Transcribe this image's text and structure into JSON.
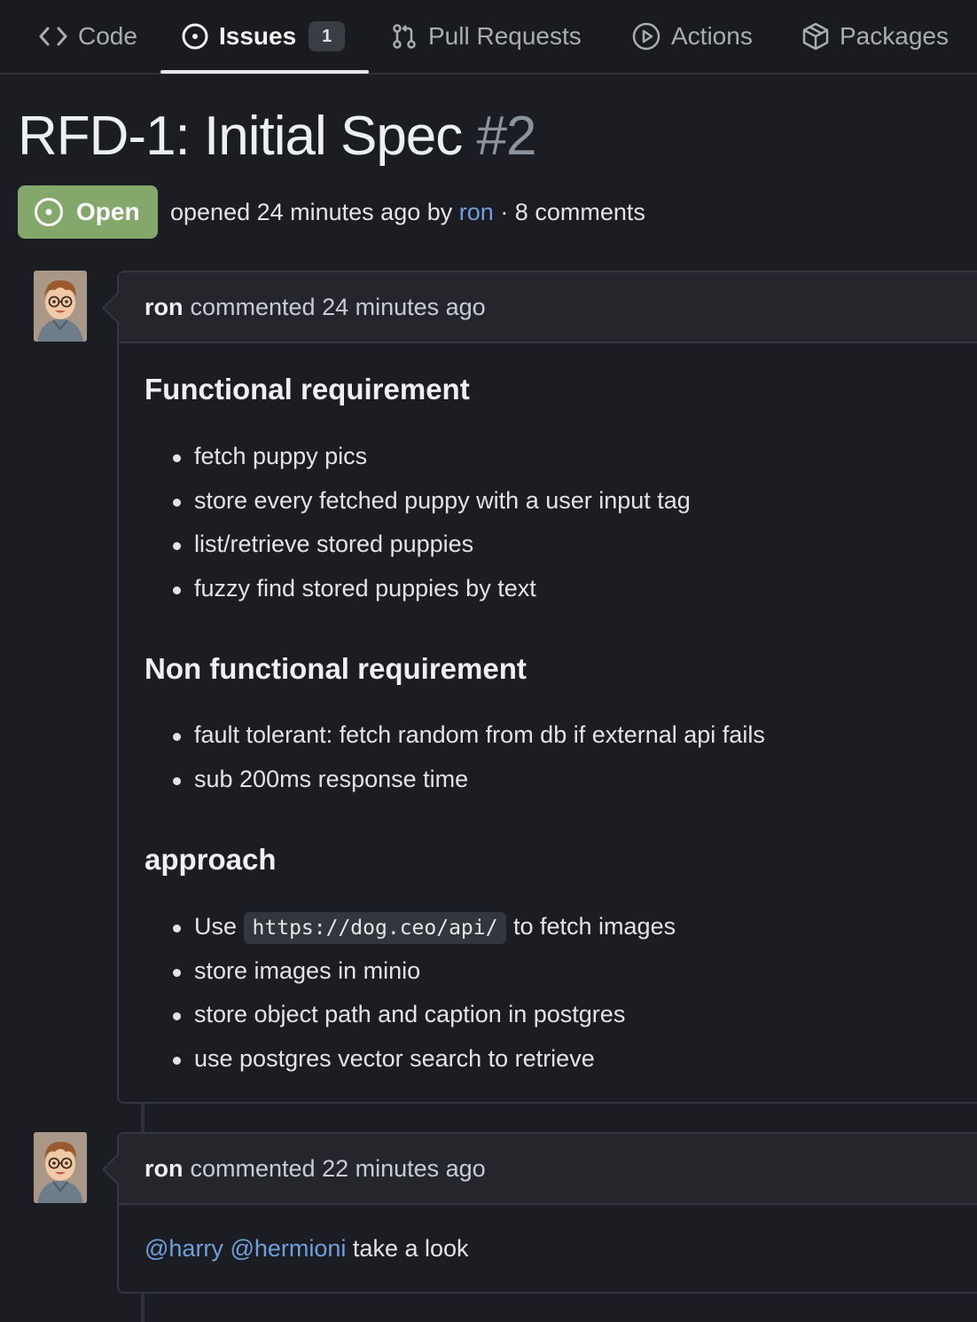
{
  "nav": {
    "tabs": [
      {
        "label": "Code",
        "icon": "code-icon"
      },
      {
        "label": "Issues",
        "icon": "issue-opened-icon",
        "count": "1",
        "active": true
      },
      {
        "label": "Pull Requests",
        "icon": "pull-request-icon"
      },
      {
        "label": "Actions",
        "icon": "play-icon"
      },
      {
        "label": "Packages",
        "icon": "package-icon"
      }
    ]
  },
  "issue": {
    "title": "RFD-1: Initial Spec",
    "number": "#2",
    "status": "Open",
    "opened_prefix": "opened 24 minutes ago by",
    "author": "ron",
    "comments_text": "· 8 comments"
  },
  "comments": [
    {
      "author": "ron",
      "action": "commented 24 minutes ago",
      "sections": [
        {
          "heading": "Functional requirement",
          "items": [
            "fetch puppy pics",
            "store every fetched puppy with a user input tag",
            "list/retrieve stored puppies",
            "fuzzy find stored puppies by text"
          ]
        },
        {
          "heading": "Non functional requirement",
          "items": [
            "fault tolerant: fetch random from db if external api fails",
            "sub 200ms response time"
          ]
        },
        {
          "heading": "approach",
          "items_prefix": "Use",
          "items_code": "https://dog.ceo/api/",
          "items_suffix": "to fetch images",
          "items": [
            "store images in minio",
            "store object path and caption in postgres",
            "use postgres vector search to retrieve"
          ]
        }
      ]
    },
    {
      "author": "ron",
      "action": "commented 22 minutes ago",
      "mention1": "@harry",
      "mention2": "@hermioni",
      "text": "take a look"
    }
  ],
  "colors": {
    "background": "#1b1d22",
    "open_badge": "#84a86b",
    "link": "#6f9fdc"
  }
}
